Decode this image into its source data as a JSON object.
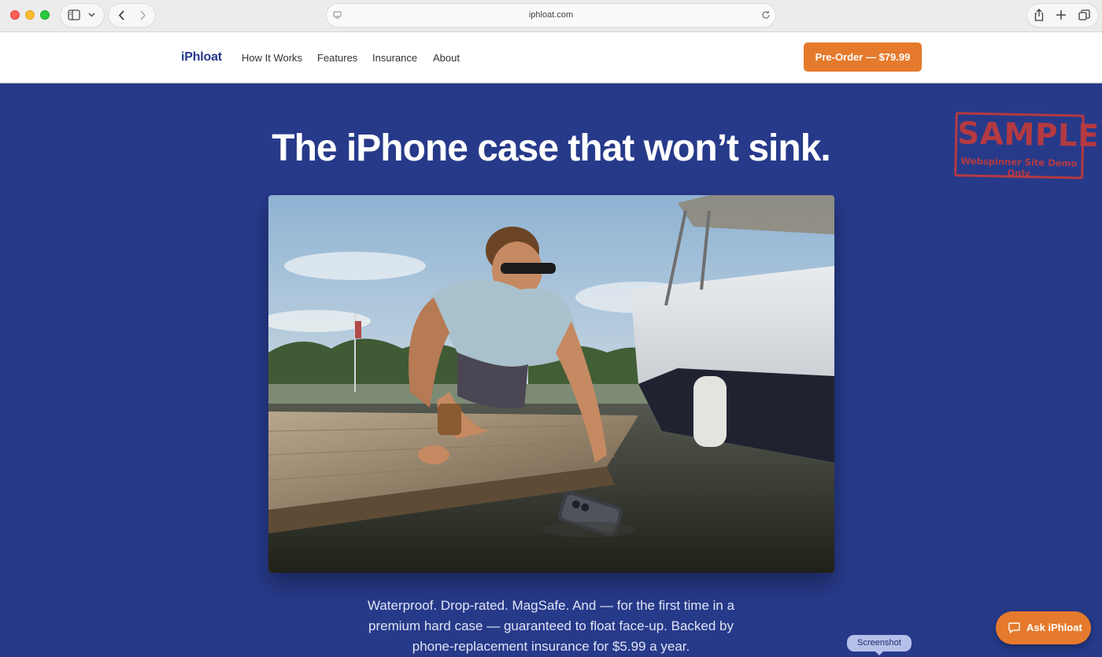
{
  "browser": {
    "url": "iphloat.com",
    "icons": {
      "sidebar": "sidebar-icon",
      "chevron": "chevron-down-icon",
      "back": "back-icon",
      "forward": "forward-icon",
      "page": "page-icon",
      "reload": "reload-icon",
      "share": "share-icon",
      "new_tab": "plus-icon",
      "tabs": "tabs-icon"
    }
  },
  "site": {
    "logo": "iPhloat",
    "nav": [
      "How It Works",
      "Features",
      "Insurance",
      "About"
    ],
    "cta": "Pre-Order — $79.99"
  },
  "hero": {
    "headline": "The iPhone case that won’t sink.",
    "subcopy": "Waterproof. Drop-rated. MagSafe. And — for the first time in a premium hard case — guaranteed to float face-up. Backed by phone-replacement insurance for $5.99 a year."
  },
  "stamp": {
    "big": "SAMPLE",
    "small": "Webspinner Site Demo Only"
  },
  "tooltip": "Screenshot",
  "chat": {
    "label": "Ask iPhloat",
    "icon": "chat-icon"
  },
  "colors": {
    "brand_blue": "#273a8a",
    "accent_orange": "#e57a2c"
  }
}
